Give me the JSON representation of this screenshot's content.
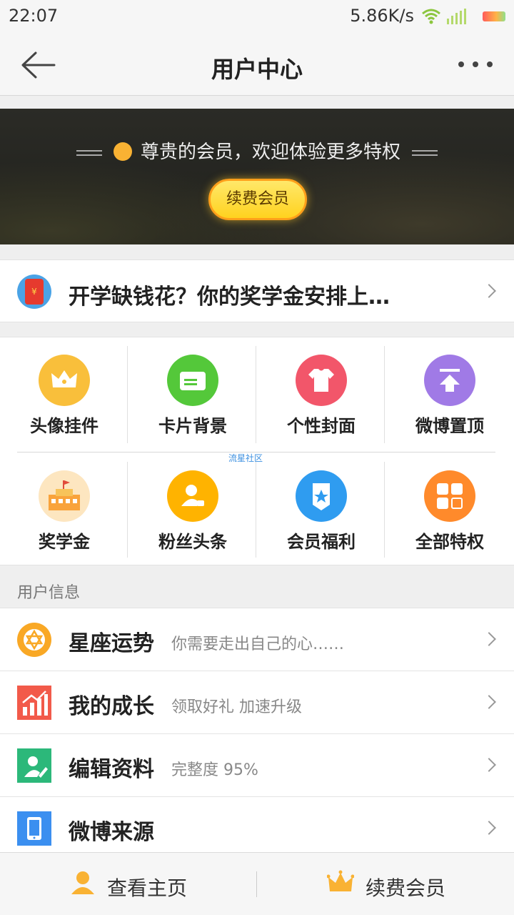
{
  "status_bar": {
    "time": "22:07",
    "net_speed": "5.86K/s"
  },
  "nav": {
    "title": "用户中心"
  },
  "banner": {
    "welcome": "尊贵的会员，欢迎体验更多特权",
    "renew_button": "续费会员"
  },
  "promo": {
    "text": "开学缺钱花？你的奖学金安排上…"
  },
  "grid": {
    "items": [
      {
        "label": "头像挂件",
        "color": "#f9bf3b"
      },
      {
        "label": "卡片背景",
        "color": "#54c83a"
      },
      {
        "label": "个性封面",
        "color": "#f2566a"
      },
      {
        "label": "微博置顶",
        "color": "#a07ae6"
      },
      {
        "label": "奖学金",
        "color": "#f9a33b"
      },
      {
        "label": "粉丝头条",
        "color": "#ffb300"
      },
      {
        "label": "会员福利",
        "color": "#2f9cf0"
      },
      {
        "label": "全部特权",
        "color": "#ff8a2b"
      }
    ],
    "watermark": "流星社区"
  },
  "user_info": {
    "section_title": "用户信息",
    "rows": [
      {
        "title": "星座运势",
        "subtitle": "你需要走出自己的心……",
        "icon_color": "#f9a825"
      },
      {
        "title": "我的成长",
        "subtitle": "领取好礼  加速升级",
        "icon_color": "#f25a4a"
      },
      {
        "title": "编辑资料",
        "subtitle": "完整度 95%",
        "icon_color": "#2cb87a"
      },
      {
        "title": "微博来源",
        "subtitle": "",
        "icon_color": "#3b8ff0"
      }
    ]
  },
  "bottom_bar": {
    "home_label": "查看主页",
    "renew_label": "续费会员"
  }
}
